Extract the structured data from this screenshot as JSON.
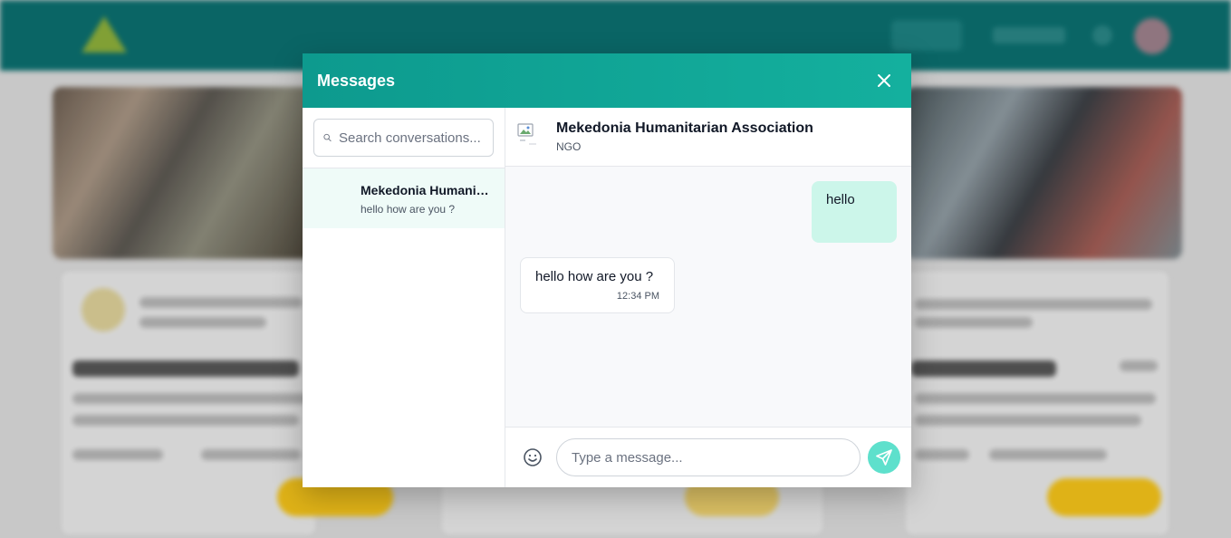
{
  "modal": {
    "title": "Messages"
  },
  "sidebar": {
    "search_placeholder": "Search conversations...",
    "conversations": [
      {
        "name": "Mekedonia Humanitarian Association",
        "preview": "hello how are you ?"
      }
    ]
  },
  "chat": {
    "contact_name": "Mekedonia Humanitarian Association",
    "contact_type": "NGO",
    "messages": [
      {
        "direction": "outgoing",
        "text": "hello"
      },
      {
        "direction": "incoming",
        "text": "hello how are you ?",
        "time": "12:34 PM"
      }
    ],
    "input_placeholder": "Type a message..."
  },
  "colors": {
    "header_gradient_start": "#0d9a8e",
    "header_gradient_end": "#14b09e",
    "outgoing_bubble": "#ccf6ea",
    "send_button": "#5ee0cc",
    "active_conversation": "#effbf8"
  },
  "icons": {
    "close": "close-icon",
    "search": "search-icon",
    "emoji": "emoji-icon",
    "send": "send-icon",
    "avatar": "broken-image-icon"
  }
}
